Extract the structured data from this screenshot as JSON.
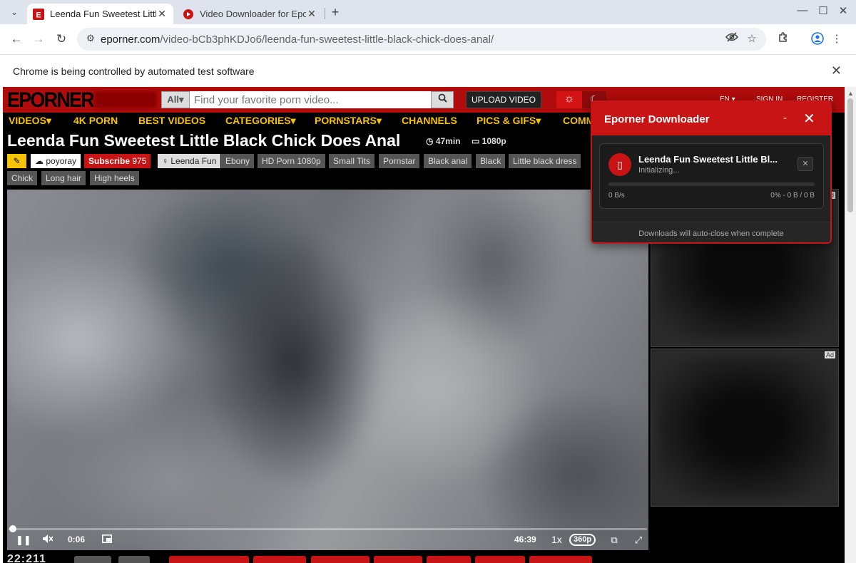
{
  "browser": {
    "tabs": [
      {
        "title": "Leenda Fun Sweetest Little Black Chick Does Anal",
        "favicon": "E"
      },
      {
        "title": "Video Downloader for Eporner"
      }
    ],
    "url_domain": "eporner.com",
    "url_path": "/video-bCb3phKDJo6/leenda-fun-sweetest-little-black-chick-does-anal/",
    "infobar_message": "Chrome is being controlled by automated test software"
  },
  "site": {
    "logo": "EPORNER",
    "search": {
      "category": "All▾",
      "placeholder": "Find your favorite porn video..."
    },
    "upload_label": "UPLOAD VIDEO",
    "header_links": [
      "EN ▾",
      "SIGN IN",
      "REGISTER"
    ],
    "nav": [
      "VIDEOS▾",
      "4K PORN",
      "BEST VIDEOS",
      "CATEGORIES▾",
      "PORNSTARS▾",
      "CHANNELS",
      "PICS & GIFS▾",
      "COMM"
    ],
    "video": {
      "title": "Leenda Fun Sweetest Little Black Chick Does Anal",
      "duration": "47min",
      "quality": "1080p"
    },
    "uploader": "poyoray",
    "subscribe_label": "Subscribe",
    "subscribe_count": "975",
    "pornstar": "Leenda Fun",
    "tags_row1": [
      "Ebony",
      "HD Porn 1080p",
      "Small Tits",
      "Pornstar",
      "Black anal",
      "Black",
      "Little black dress"
    ],
    "tags_row2": [
      "Chick",
      "Long hair",
      "High heels"
    ],
    "player": {
      "current_time": "0:06",
      "total_time": "46:39",
      "speed": "1x",
      "quality": "360p",
      "progress": 0.002
    },
    "bottom_text": "22:211",
    "ad_label": "Ad"
  },
  "extension": {
    "title": "Eporner Downloader",
    "minimize": "-",
    "download": {
      "name": "Leenda Fun Sweetest Little Black Chick Does Anal",
      "name_display": "Leenda Fun Sweetest Little Bl...",
      "status": "Initializing...",
      "speed": "0 B/s",
      "progress_text": "0% - 0 B / 0 B",
      "progress": 0
    },
    "footer": "Downloads will auto-close when complete"
  }
}
